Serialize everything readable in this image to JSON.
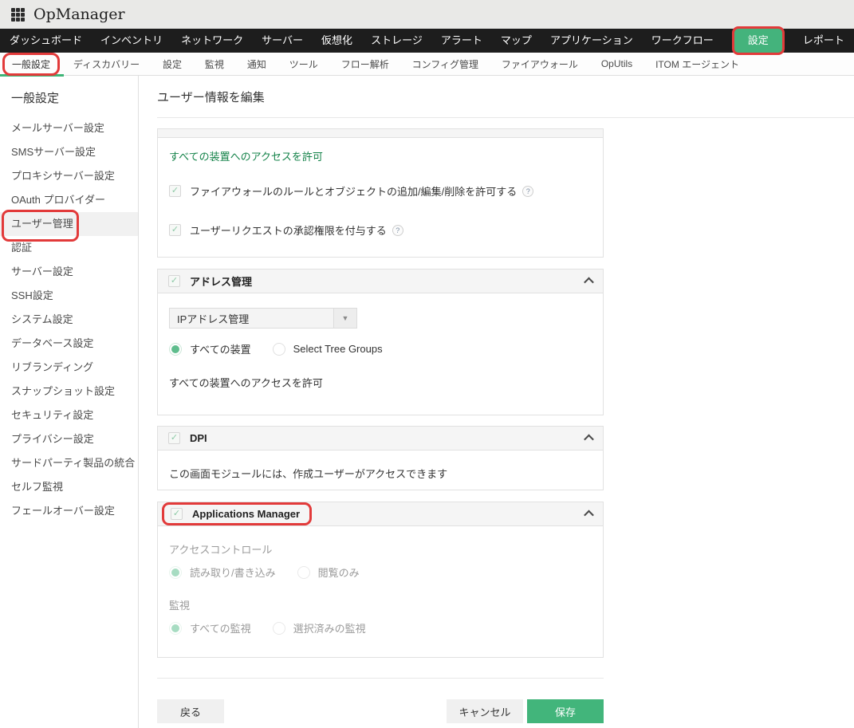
{
  "header": {
    "logo": "OpManager"
  },
  "nav": {
    "items": [
      "ダッシュボード",
      "インベントリ",
      "ネットワーク",
      "サーバー",
      "仮想化",
      "ストレージ",
      "アラート",
      "マップ",
      "アプリケーション",
      "ワークフロー",
      "設定",
      "レポート"
    ],
    "active": "設定"
  },
  "subnav": {
    "items": [
      "一般設定",
      "ディスカバリー",
      "設定",
      "監視",
      "通知",
      "ツール",
      "フロー解析",
      "コンフィグ管理",
      "ファイアウォール",
      "OpUtils",
      "ITOM エージェント"
    ],
    "active": "一般設定"
  },
  "sidebar": {
    "title": "一般設定",
    "items": [
      "メールサーバー設定",
      "SMSサーバー設定",
      "プロキシサーバー設定",
      "OAuth プロバイダー",
      "ユーザー管理",
      "認証",
      "サーバー設定",
      "SSH設定",
      "システム設定",
      "データベース設定",
      "リブランディング",
      "スナップショット設定",
      "セキュリティ設定",
      "プライバシー設定",
      "サードパーティ製品の統合",
      "セルフ監視",
      "フェールオーバー設定"
    ],
    "active": "ユーザー管理"
  },
  "main": {
    "title": "ユーザー情報を編集",
    "access_panel": {
      "allow_link": "すべての装置へのアクセスを許可",
      "checkbox1": "ファイアウォールのルールとオブジェクトの追加/編集/削除を許可する",
      "checkbox2": "ユーザーリクエストの承認権限を付与する"
    },
    "address_section": {
      "title": "アドレス管理",
      "dropdown_value": "IPアドレス管理",
      "radio1": "すべての装置",
      "radio2": "Select Tree Groups",
      "note": "すべての装置へのアクセスを許可"
    },
    "dpi_section": {
      "title": "DPI",
      "note": "この画面モジュールには、作成ユーザーがアクセスできます"
    },
    "apps_manager_section": {
      "title": "Applications Manager",
      "access_control_label": "アクセスコントロール",
      "access_radio1": "読み取り/書き込み",
      "access_radio2": "閲覧のみ",
      "monitoring_label": "監視",
      "monitor_radio1": "すべての監視",
      "monitor_radio2": "選択済みの監視"
    },
    "buttons": {
      "back": "戻る",
      "cancel": "キャンセル",
      "save": "保存"
    }
  },
  "icons": {
    "checkmark": "✓",
    "help": "?",
    "dropdown_caret": "▼"
  },
  "colors": {
    "accent_green": "#44b37c",
    "save_green": "#42b57b",
    "link_green": "#15834a",
    "annotation_red": "#e23a3a",
    "nav_black": "#1d1d1d",
    "topbar_gray": "#e9e9e7"
  },
  "annotations": {
    "highlighted_elements": [
      "設定",
      "一般設定",
      "ユーザー管理",
      "Applications Manager"
    ]
  }
}
